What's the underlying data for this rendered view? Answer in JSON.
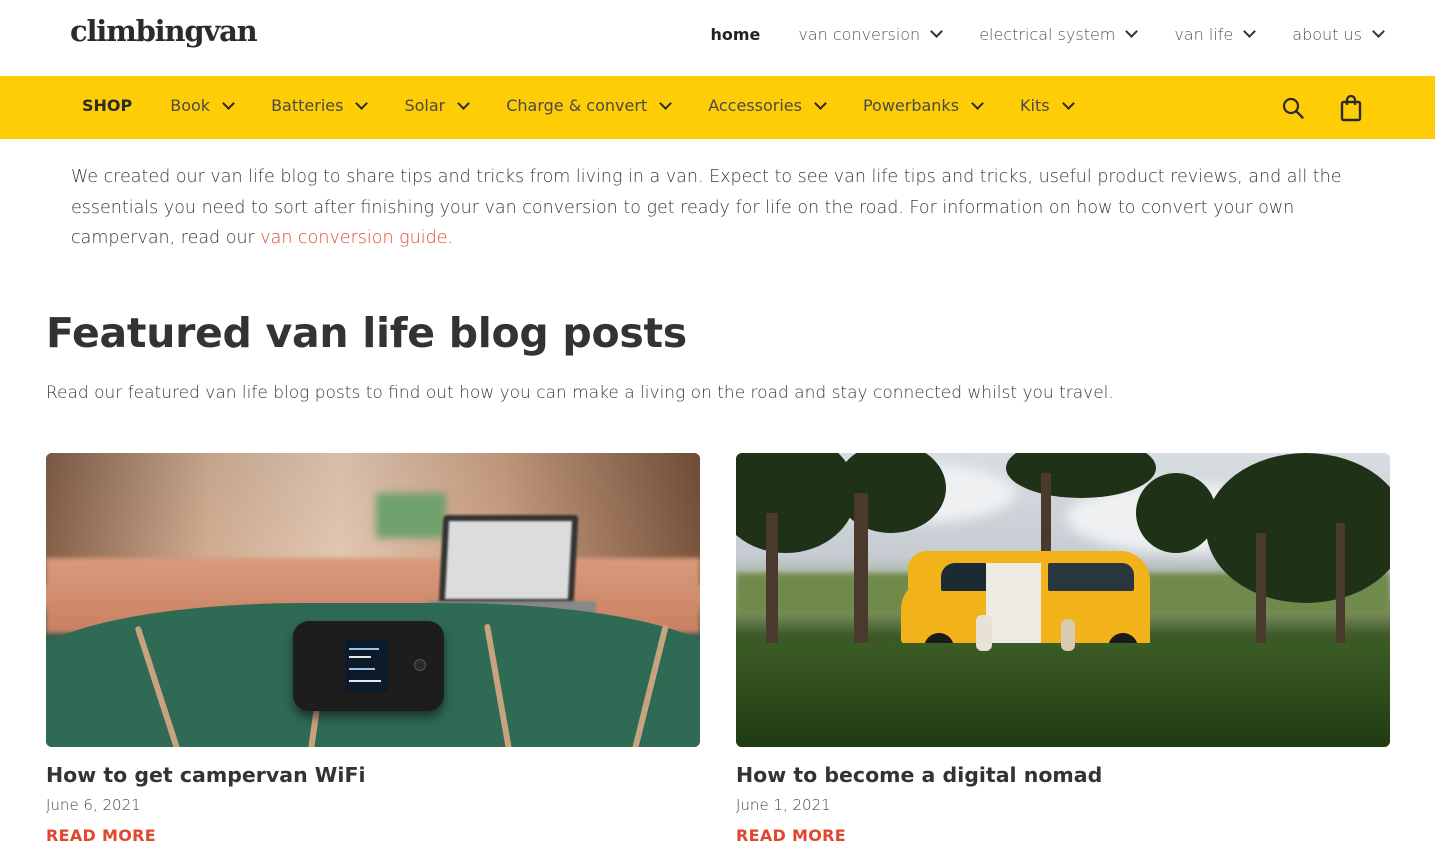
{
  "header": {
    "logo": "climbingvan",
    "nav": [
      {
        "label": "home",
        "active": true,
        "dropdown": false
      },
      {
        "label": "van conversion",
        "active": false,
        "dropdown": true
      },
      {
        "label": "electrical system",
        "active": false,
        "dropdown": true
      },
      {
        "label": "van life",
        "active": false,
        "dropdown": true
      },
      {
        "label": "about us",
        "active": false,
        "dropdown": true
      }
    ]
  },
  "shopbar": {
    "background_color": "#ffcd05",
    "items": [
      {
        "label": "SHOP",
        "dropdown": false
      },
      {
        "label": "Book",
        "dropdown": true
      },
      {
        "label": "Batteries",
        "dropdown": true
      },
      {
        "label": "Solar",
        "dropdown": true
      },
      {
        "label": "Charge & convert",
        "dropdown": true
      },
      {
        "label": "Accessories",
        "dropdown": true
      },
      {
        "label": "Powerbanks",
        "dropdown": true
      },
      {
        "label": "Kits",
        "dropdown": true
      }
    ],
    "icons": [
      "search-icon",
      "shopping-bag-icon"
    ]
  },
  "intro": {
    "text_before_link": "We created our van life blog to share tips and tricks from living in a van. Expect to see van life tips and tricks, useful product reviews, and all the essentials you need to sort after finishing your van conversion to get ready for life on the road. For information on how to convert your own campervan, read our ",
    "link_text": "van conversion guide",
    "text_after_link": ".",
    "link_color": "#e0472c"
  },
  "featured": {
    "title": "Featured van life blog posts",
    "description": "Read our featured van life blog posts to find out how you can make a living on the road and stay connected whilst you travel.",
    "posts": [
      {
        "title": "How to get campervan WiFi",
        "date": "June 6, 2021",
        "read_more": "READ MORE"
      },
      {
        "title": "How to become a digital nomad",
        "date": "June 1, 2021",
        "read_more": "READ MORE"
      }
    ]
  }
}
